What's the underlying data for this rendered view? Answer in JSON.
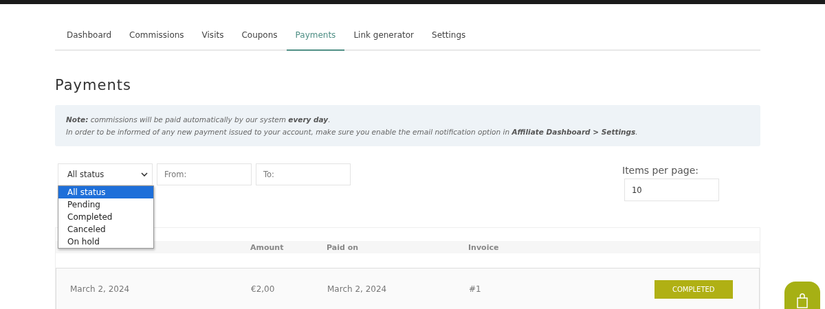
{
  "tabs": [
    {
      "label": "Dashboard",
      "selected": false
    },
    {
      "label": "Commissions",
      "selected": false
    },
    {
      "label": "Visits",
      "selected": false
    },
    {
      "label": "Coupons",
      "selected": false
    },
    {
      "label": "Payments",
      "selected": true
    },
    {
      "label": "Link generator",
      "selected": false
    },
    {
      "label": "Settings",
      "selected": false
    }
  ],
  "heading": "Payments",
  "note": [
    "**Note:** commissions will be paid automatically by our system **every day**.",
    "In order to be informed of any new payment issued to your account, make sure you enable the email notification option in **Affiliate Dashboard > Settings**."
  ],
  "filters": {
    "status": {
      "value": "All status",
      "expanded": true,
      "options": [
        {
          "label": "All status",
          "selected": true
        },
        {
          "label": "Pending",
          "selected": false
        },
        {
          "label": "Completed",
          "selected": false
        },
        {
          "label": "Canceled",
          "selected": false
        },
        {
          "label": "On hold",
          "selected": false
        }
      ]
    },
    "from": {
      "placeholder": "From:"
    },
    "to": {
      "placeholder": "To:"
    }
  },
  "items_per_page": {
    "label": "Items per page:",
    "value": "10"
  },
  "table": {
    "columns": [
      "Amount",
      "Paid on",
      "Invoice"
    ],
    "rows": [
      {
        "requested_on": "March 2, 2024",
        "amount": "€2,00",
        "paid_on": "March 2, 2024",
        "invoice": "#1",
        "status": "COMPLETED"
      }
    ]
  }
}
